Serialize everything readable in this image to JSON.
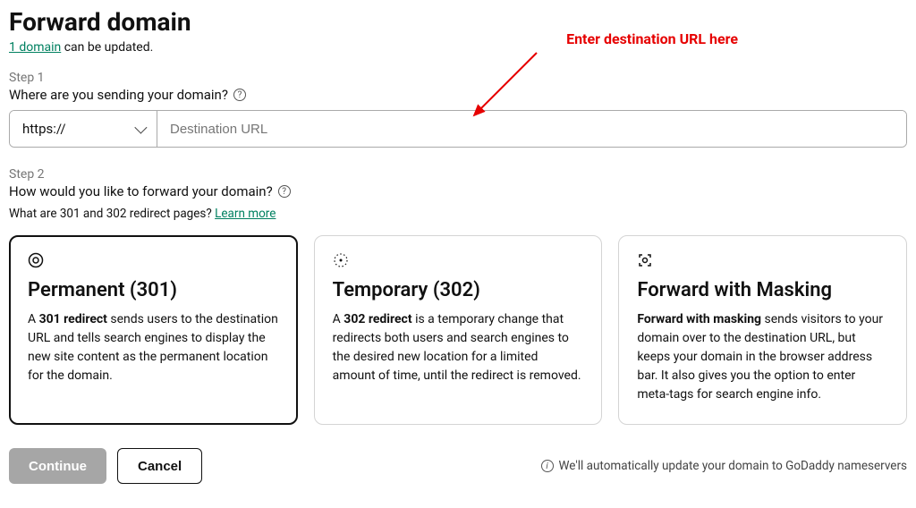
{
  "title": "Forward domain",
  "subtitle_link": "1 domain",
  "subtitle_rest": " can be updated.",
  "step1": {
    "label": "Step 1",
    "question": "Where are you sending your domain?",
    "protocol": "https://",
    "placeholder": "Destination URL"
  },
  "step2": {
    "label": "Step 2",
    "question": "How would you like to forward your domain?",
    "note_prefix": "What are 301 and 302 redirect pages? ",
    "learn_more": "Learn more"
  },
  "cards": {
    "permanent": {
      "title": "Permanent (301)",
      "desc_prefix": "A ",
      "desc_bold": "301 redirect",
      "desc_rest": " sends users to the destination URL and tells search engines to display the new site content as the permanent location for the domain."
    },
    "temporary": {
      "title": "Temporary (302)",
      "desc_prefix": "A ",
      "desc_bold": "302 redirect",
      "desc_rest": " is a temporary change that redirects both users and search engines to the desired new location for a limited amount of time, until the redirect is removed."
    },
    "masking": {
      "title": "Forward with Masking",
      "desc_bold": "Forward with masking",
      "desc_rest": " sends visitors to your domain over to the destination URL, but keeps your domain in the browser address bar. It also gives you the option to enter meta-tags for search engine info."
    }
  },
  "buttons": {
    "continue": "Continue",
    "cancel": "Cancel"
  },
  "footer_note": "We'll automatically update your domain to GoDaddy nameservers",
  "annotation": "Enter destination URL here"
}
